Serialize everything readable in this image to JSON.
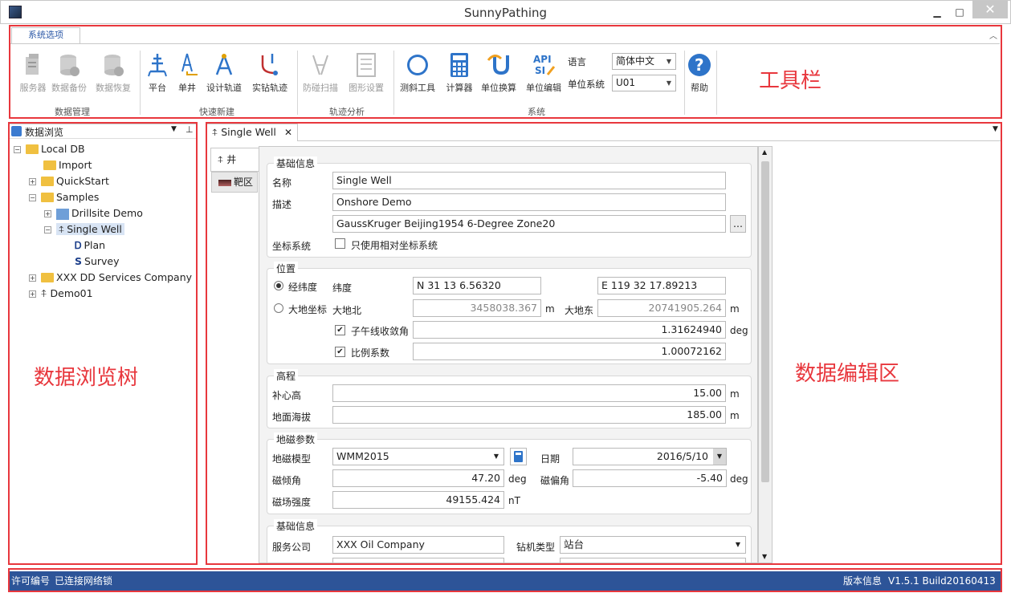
{
  "window": {
    "title": "SunnyPathing",
    "minimize": "▁",
    "maximize": "□",
    "close": "✕"
  },
  "ribbon": {
    "tab": "系统选项",
    "collapse": "︿",
    "buttons": {
      "server": "服务器",
      "backup": "数据备份",
      "restore": "数据恢复",
      "platform": "平台",
      "well": "单井",
      "design": "设计轨道",
      "drilled": "实钻轨迹",
      "anticollision": "防碰扫描",
      "graphics": "图形设置",
      "survey_tool": "测斜工具",
      "calculator": "计算器",
      "unit_convert": "单位换算",
      "unit_edit": "单位编辑",
      "help": "帮助"
    },
    "groups": {
      "data": "数据管理",
      "quick": "快速新建",
      "analysis": "轨迹分析",
      "system": "系统"
    },
    "language_label": "语言",
    "language_value": "简体中文",
    "unit_label": "单位系统",
    "unit_value": "U01"
  },
  "tree": {
    "header": "数据浏览",
    "nodes": [
      "Local DB",
      "Import",
      "QuickStart",
      "Samples",
      "Drillsite Demo",
      "Single Well",
      "Plan",
      "Survey",
      "XXX DD Services Company",
      "Demo01"
    ]
  },
  "editor": {
    "tab": "Single Well",
    "vtab_well": "井",
    "vtab_target": "靶区",
    "basic": {
      "title": "基础信息",
      "name_label": "名称",
      "name_value": "Single Well",
      "desc_label": "描述",
      "desc_value": "Onshore Demo",
      "crs_value": "GaussKruger Beijing1954 6-Degree Zone20",
      "crs_label": "坐标系统",
      "relative": "只使用相对坐标系统",
      "browse": "..."
    },
    "position": {
      "title": "位置",
      "latlon": "经纬度",
      "lat_label": "纬度",
      "lat": "N 31 13 6.56320",
      "lon": "E 119 32 17.89213",
      "geodetic": "大地坐标",
      "north_label": "大地北",
      "north": "3458038.367",
      "m1": "m",
      "east_label": "大地东",
      "east": "20741905.264",
      "m2": "m",
      "conv_label": "子午线收敛角",
      "conv": "1.31624940",
      "deg": "deg",
      "scale_label": "比例系数",
      "scale": "1.00072162"
    },
    "elevation": {
      "title": "高程",
      "kb_label": "补心高",
      "kb": "15.00",
      "kb_unit": "m",
      "ground_label": "地面海拔",
      "ground": "185.00",
      "ground_unit": "m"
    },
    "magnetic": {
      "title": "地磁参数",
      "model_label": "地磁模型",
      "model": "WMM2015",
      "date_label": "日期",
      "date": "2016/5/10",
      "dip_label": "磁倾角",
      "dip": "47.20",
      "dip_unit": "deg",
      "decl_label": "磁偏角",
      "decl": "-5.40",
      "decl_unit": "deg",
      "field_label": "磁场强度",
      "field": "49155.424",
      "field_unit": "nT"
    },
    "basic2": {
      "title": "基础信息",
      "company_label": "服务公司",
      "company": "XXX Oil Company",
      "rig_label": "钻机类型",
      "rig": "站台"
    }
  },
  "status": {
    "license": "许可编号",
    "network": "已连接网络锁",
    "version_label": "版本信息",
    "version": "V1.5.1 Build20160413"
  },
  "annotations": {
    "toolbar": "工具栏",
    "tree": "数据浏览树",
    "editor": "数据编辑区"
  }
}
